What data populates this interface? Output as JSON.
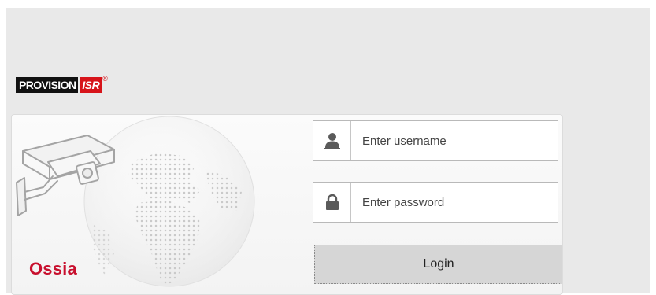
{
  "brand": {
    "name": "PROVISION",
    "suffix": "ISR",
    "registered_mark": "®"
  },
  "login_panel": {
    "product_name": "Ossia",
    "username": {
      "placeholder": "Enter username",
      "value": "",
      "icon": "user-icon"
    },
    "password": {
      "placeholder": "Enter password",
      "value": "",
      "icon": "lock-icon"
    },
    "login_label": "Login"
  },
  "colors": {
    "page_background": "#e9e9e9",
    "brand_red": "#c8102e",
    "button_background": "#d6d6d6"
  },
  "illustration": {
    "icons": [
      "security-camera-icon",
      "globe-icon"
    ]
  }
}
